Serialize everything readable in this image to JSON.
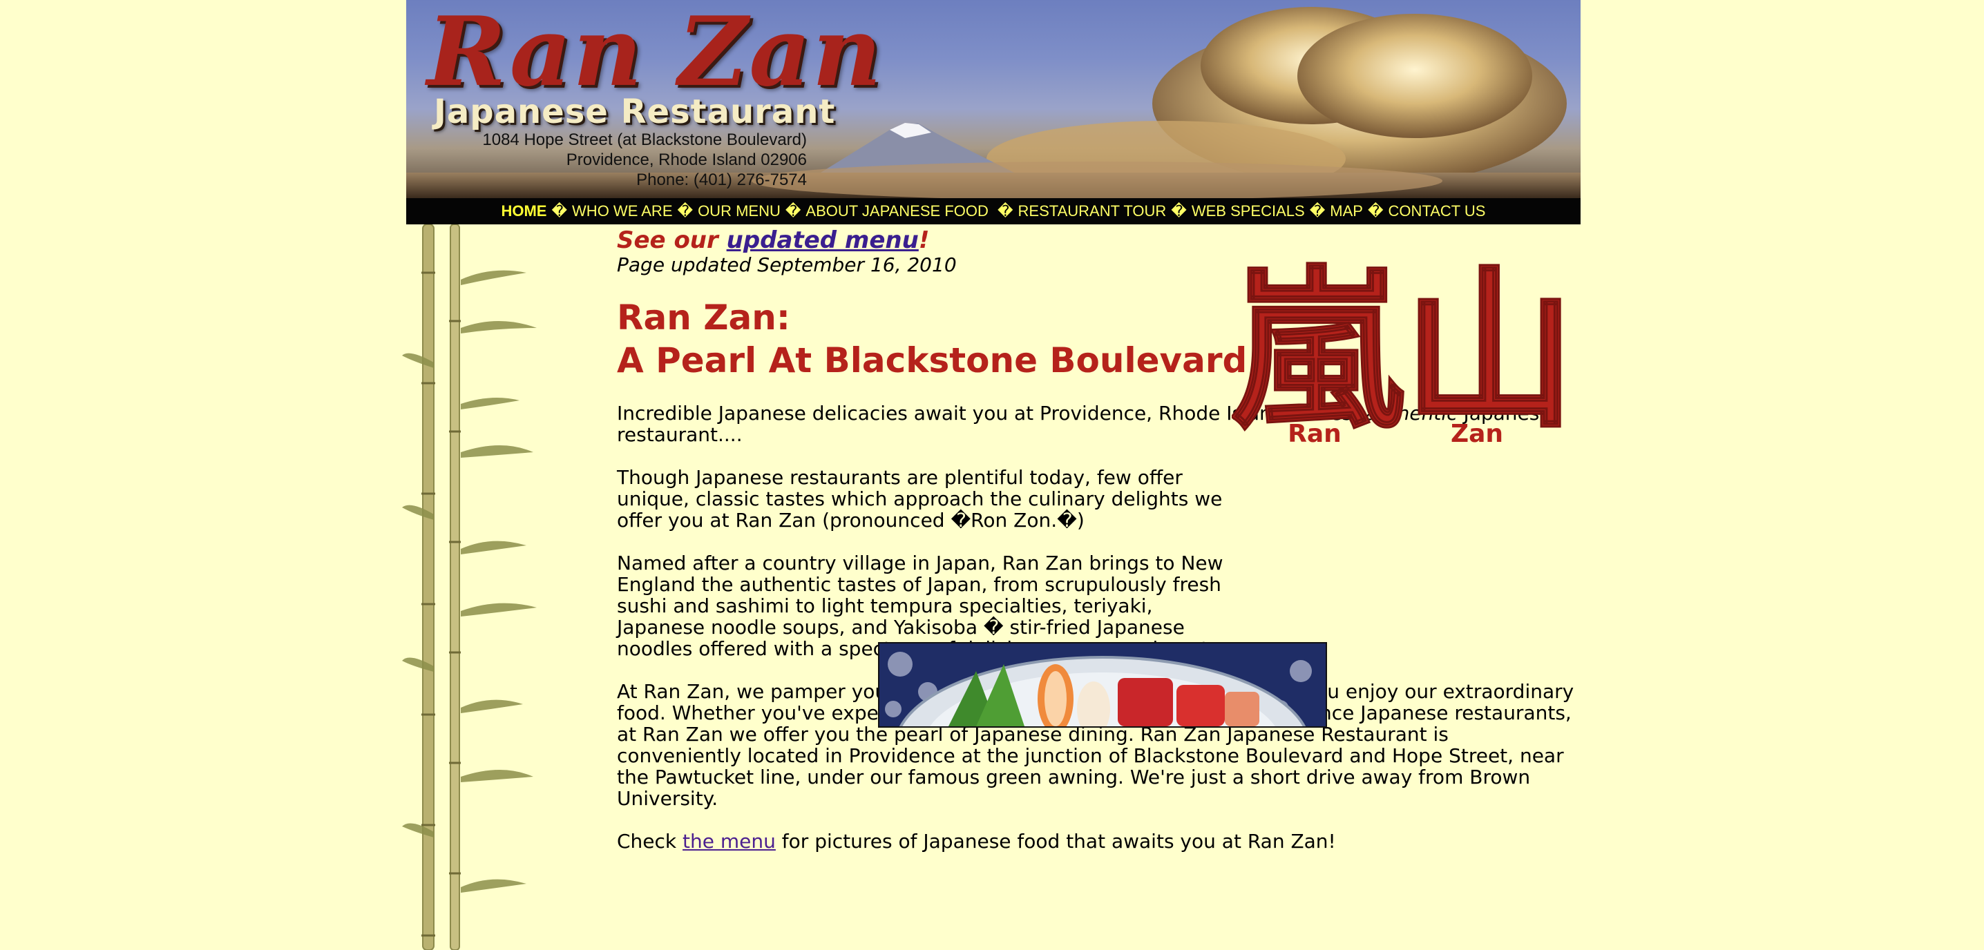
{
  "header": {
    "title": "Ran Zan",
    "subtitle": "Japanese Restaurant",
    "address_line1": "1084 Hope Street (at Blackstone Boulevard)",
    "address_line2": "Providence, Rhode Island 02906",
    "phone": "Phone: (401) 276-7574"
  },
  "nav": {
    "separator": "�",
    "items": [
      {
        "label": "HOME",
        "active": true
      },
      {
        "label": "WHO WE ARE"
      },
      {
        "label": "OUR MENU"
      },
      {
        "label": "ABOUT JAPANESE FOOD "
      },
      {
        "label": "RESTAURANT TOUR"
      },
      {
        "label": "WEB SPECIALS"
      },
      {
        "label": "MAP"
      },
      {
        "label": "CONTACT US"
      }
    ]
  },
  "notice": {
    "prefix": "See our ",
    "link": "updated menu",
    "suffix": "!",
    "updated": "Page updated September 16, 2010"
  },
  "heading": {
    "line1": "Ran Zan:",
    "line2": "A Pearl At Blackstone Boulevard"
  },
  "paragraphs": {
    "p1_before": "Incredible Japanese delicacies await you at Providence, Rhode Island's finest ",
    "p1_em": "authentic",
    "p1_after": " Japanese restaurant....",
    "p2": "Though Japanese restaurants are plentiful today, few offer unique, classic tastes which approach the culinary delights we offer you at Ran Zan (pronounced �Ron Zon.�)",
    "p3": "Named after a country village in Japan, Ran Zan brings to New England the authentic tastes of Japan, from scrupulously fresh sushi and sashimi to light tempura specialties, teriyaki, Japanese noodle soups, and Yakisoba � stir-fried Japanese noodles offered with a spectrum of delicious accompaniments.",
    "p4": "At Ran Zan, we pamper you with traditional Japanese hospitality while you enjoy our extraordinary food. Whether you've experienced Japanese cuisine in Boston or Providence Japanese restaurants, at Ran Zan we offer you the pearl of Japanese dining. Ran Zan Japanese Restaurant is conveniently located in Providence at the junction of Blackstone Boulevard and Hope Street, near the Pawtucket line, under our famous green awning. We're just a short drive away from Brown University.",
    "p5_before": "Check ",
    "p5_link": "the menu",
    "p5_after": " for pictures of Japanese food that awaits you at Ran Zan!"
  },
  "kanji_logo": {
    "kanji": "嵐山",
    "label_left": "Ran",
    "label_right": "Zan"
  },
  "colors": {
    "background": "#ffffcc",
    "accent_red": "#b5221b",
    "nav_bg": "#050505",
    "nav_text": "#ffff66",
    "link": "#4b1f8f"
  }
}
